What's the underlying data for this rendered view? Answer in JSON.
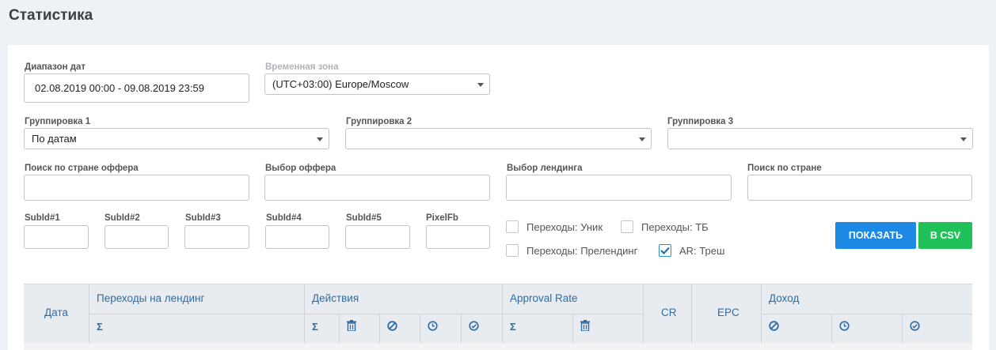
{
  "page": {
    "title": "Статистика"
  },
  "filters": {
    "date_range": {
      "label": "Диапазон дат",
      "value": "02.08.2019 00:00 - 09.08.2019 23:59"
    },
    "timezone": {
      "label": "Временная зона",
      "value": "(UTC+03:00) Europe/Moscow"
    },
    "grouping1": {
      "label": "Группировка 1",
      "value": "По датам"
    },
    "grouping2": {
      "label": "Группировка 2",
      "value": ""
    },
    "grouping3": {
      "label": "Группировка 3",
      "value": ""
    },
    "offer_country": {
      "label": "Поиск по стране оффера",
      "value": ""
    },
    "offer": {
      "label": "Выбор оффера",
      "value": ""
    },
    "landing": {
      "label": "Выбор лендинга",
      "value": ""
    },
    "country": {
      "label": "Поиск по стране",
      "value": ""
    },
    "subids": [
      {
        "label": "SubId#1",
        "value": ""
      },
      {
        "label": "SubId#2",
        "value": ""
      },
      {
        "label": "SubId#3",
        "value": ""
      },
      {
        "label": "SubId#4",
        "value": ""
      },
      {
        "label": "SubId#5",
        "value": ""
      },
      {
        "label": "PixelFb",
        "value": ""
      }
    ],
    "checkboxes": [
      {
        "label": "Переходы: Уник",
        "checked": false
      },
      {
        "label": "Переходы: ТБ",
        "checked": false
      },
      {
        "label": "Переходы: Прелендинг",
        "checked": false
      },
      {
        "label": "AR: Треш",
        "checked": true
      }
    ]
  },
  "buttons": {
    "show": "ПОКАЗАТЬ",
    "csv": "В CSV"
  },
  "colors": {
    "primary": "#1e88e5",
    "success": "#21c15a",
    "header_text": "#2e6da4"
  },
  "table": {
    "headers": {
      "date": "Дата",
      "landing_clicks": "Переходы на лендинг",
      "actions": "Действия",
      "approval_rate": "Approval Rate",
      "cr": "CR",
      "epc": "EPC",
      "income": "Доход"
    },
    "sub": {
      "sigma": "Σ"
    }
  }
}
